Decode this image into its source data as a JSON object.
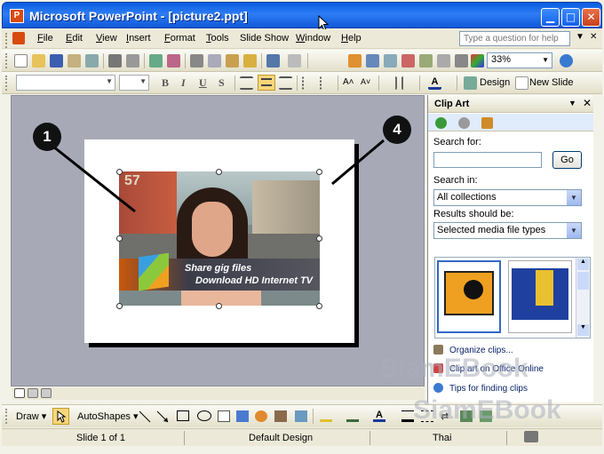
{
  "window": {
    "app_icon_letter": "P",
    "title": "Microsoft PowerPoint - [picture2.ppt]",
    "min_glyph": "▁",
    "max_glyph": "□",
    "close_glyph": "✕"
  },
  "menu": {
    "items": [
      {
        "u": "F",
        "rest": "ile"
      },
      {
        "u": "E",
        "rest": "dit"
      },
      {
        "u": "V",
        "rest": "iew"
      },
      {
        "u": "I",
        "rest": "nsert"
      },
      {
        "u": "F",
        "rest": "ormat"
      },
      {
        "u": "T",
        "rest": "ools"
      },
      {
        "u": "",
        "rest": "Slide Show"
      },
      {
        "u": "W",
        "rest": "indow"
      },
      {
        "u": "H",
        "rest": "elp"
      }
    ],
    "ask_placeholder": "Type a question for help"
  },
  "toolbar": {
    "zoom": "33%",
    "design_label": "Design",
    "new_slide_label": "New Slide",
    "bold": "B",
    "italic": "I",
    "underline": "U",
    "shadow": "S"
  },
  "picture": {
    "banner_line1": "Share gig files",
    "banner_line2": "Download HD Internet TV",
    "sign_number": "57"
  },
  "callouts": {
    "left": "1",
    "right": "4"
  },
  "task_pane": {
    "title": "Clip Art",
    "search_for_label": "Search for:",
    "search_value": "",
    "go_label": "Go",
    "search_in_label": "Search in:",
    "search_in_value": "All collections",
    "results_label": "Results should be:",
    "results_value": "Selected media file types",
    "links": [
      "Organize clips...",
      "Clip art on Office Online",
      "Tips for finding clips"
    ]
  },
  "drawing": {
    "draw_label": "Draw",
    "autoshapes_label": "AutoShapes"
  },
  "status": {
    "slide": "Slide 1 of 1",
    "design": "Default Design",
    "language": "Thai"
  },
  "watermark": "SiamEBook",
  "colors": {
    "titlebar": "#1058d8",
    "workspace": "#a8a9b7",
    "pane_nav": "#e0ecfc",
    "active_button": "#f7d67a"
  }
}
